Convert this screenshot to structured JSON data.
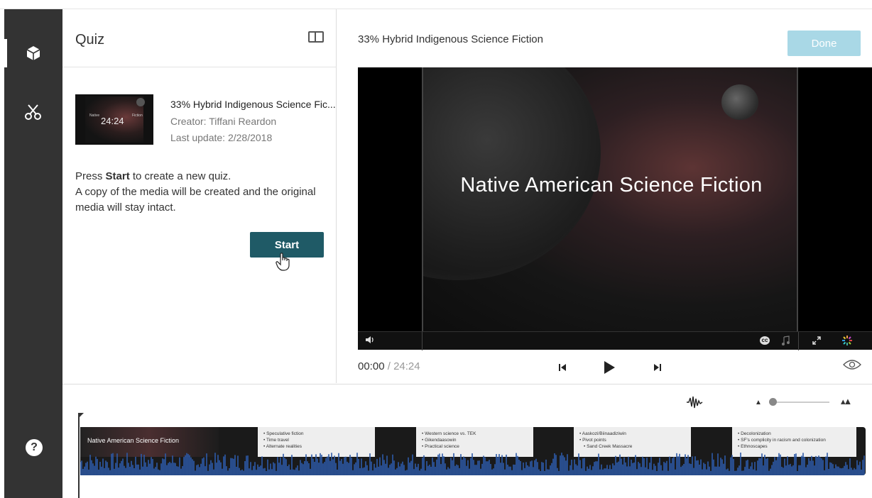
{
  "rail": {
    "items": [
      {
        "name": "quiz",
        "icon": "cube-icon"
      },
      {
        "name": "trim",
        "icon": "scissors-icon"
      }
    ],
    "help_label": "?"
  },
  "panel": {
    "title": "Quiz",
    "media": {
      "title": "33% Hybrid Indigenous Science Fic...",
      "creator": "Creator: Tiffani Reardon",
      "updated": "Last update: 2/28/2018",
      "thumb_duration": "24:24",
      "thumb_left": "Native",
      "thumb_right": "Fiction"
    },
    "desc_prefix": "Press ",
    "desc_bold": "Start",
    "desc_suffix": " to create a new quiz.",
    "desc_line2": "A copy of the media will be created and the original media will stay intact.",
    "start_label": "Start"
  },
  "viewer": {
    "title": "33% Hybrid Indigenous Science Fiction",
    "done_label": "Done",
    "video_caption": "Native American Science Fiction",
    "cc_label": "cc",
    "current_time": "00:00",
    "separator": " / ",
    "duration": "24:24"
  },
  "timeline": {
    "zoom_level": 0,
    "slides": [
      {
        "kind": "dark",
        "title": "Native American Science Fiction"
      },
      {
        "kind": "light",
        "bullets": [
          "Speculative fiction",
          "Time travel",
          "Alternate realities"
        ]
      },
      {
        "kind": "light",
        "bullets": [
          "Western science vs. TEK",
          "Gikendaasowin",
          "Practical science"
        ]
      },
      {
        "kind": "light",
        "bullets": [
          "Aaskozi/Biinaadiziwin",
          "Pivot points",
          "Sand Creek Massacre"
        ]
      },
      {
        "kind": "light",
        "bullets": [
          "Decolonization",
          "SF's complicity in racism and colonization",
          "Ethnoscapes"
        ]
      }
    ],
    "wave_color": "#2d5aa8"
  }
}
